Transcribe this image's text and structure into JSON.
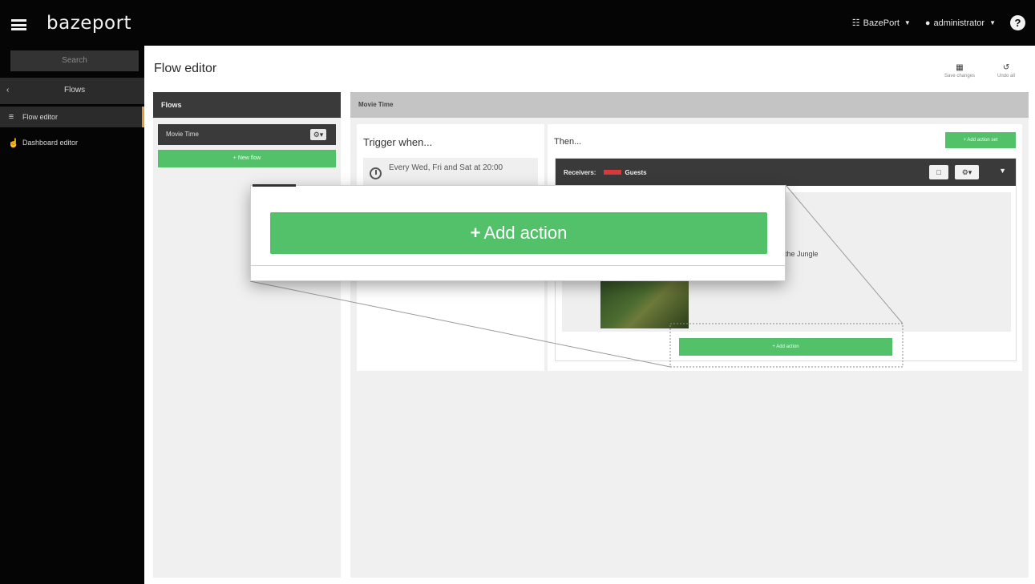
{
  "topbar": {
    "logo": "bazeport",
    "org_menu": "BazePort",
    "user_menu": "administrator",
    "help_symbol": "?"
  },
  "sidebar": {
    "search_placeholder": "Search",
    "back_label": "Flows",
    "items": [
      {
        "label": "Flow editor",
        "icon": "list-icon",
        "active": true
      },
      {
        "label": "Dashboard editor",
        "icon": "hand-pointer-icon",
        "active": false
      }
    ]
  },
  "header": {
    "title": "Flow editor",
    "save_label": "Save changes",
    "undo_label": "Undo all"
  },
  "flows": {
    "header": "Flows",
    "items": [
      {
        "name": "Movie Time"
      }
    ],
    "new_flow_label": "+ New flow"
  },
  "editor": {
    "flow_name": "Movie Time",
    "trigger": {
      "title": "Trigger when...",
      "schedule": "Every Wed, Fri and Sat at 20:00"
    },
    "then": {
      "title": "Then...",
      "add_action_set_label": "+ Add action set",
      "receivers_label": "Receivers:",
      "receivers_value": "Guests",
      "action_caption": "the Jungle",
      "add_action_label": "+ Add action"
    }
  },
  "zoom": {
    "add_action_label": "Add action",
    "plus": "+"
  },
  "colors": {
    "topbar": "#050505",
    "accent_green": "#52c16a",
    "active_marker": "#e29a3a",
    "tag_red": "#d63b3b"
  }
}
